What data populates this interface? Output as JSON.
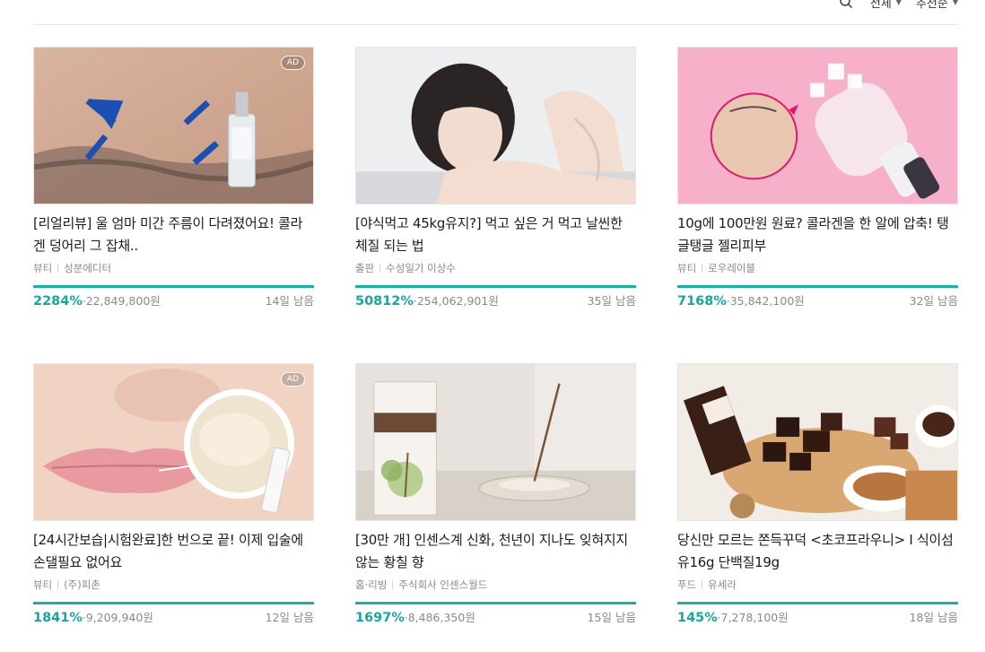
{
  "toolbar": {
    "search_icon": "search-icon",
    "filter_label": "전체",
    "sort_label": "추천순"
  },
  "cards": [
    {
      "ad": "AD",
      "title": "[리얼리뷰] 울 엄마 미간 주름이 다려졌어요! 콜라겐 덩어리 그 잡채..",
      "category": "뷰티",
      "maker": "성분에디터",
      "percent": "2284%",
      "amount": "22,849,800원",
      "days": "14일 남음",
      "progress": 1.0
    },
    {
      "ad": "",
      "title": "[야식먹고 45kg유지?] 먹고 싶은 거 먹고 날씬한 체질 되는 법",
      "category": "출판",
      "maker": "수성일기 이상수",
      "percent": "50812%",
      "amount": "254,062,901원",
      "days": "35일 남음",
      "progress": 1.0
    },
    {
      "ad": "",
      "title": "10g에 100만원 원료? 콜라겐을 한 알에 압축! 탱글탱글 젤리피부",
      "category": "뷰티",
      "maker": "로우레이블",
      "percent": "7168%",
      "amount": "35,842,100원",
      "days": "32일 남음",
      "progress": 1.0
    },
    {
      "ad": "AD",
      "title": "[24시간보습|시험완료]한 번으로 끝! 이제 입술에 손댈필요 없어요",
      "category": "뷰티",
      "maker": "(주)피촌",
      "percent": "1841%",
      "amount": "9,209,940원",
      "days": "12일 남음",
      "progress": 1.0
    },
    {
      "ad": "",
      "title": "[30만 개] 인센스계 신화, 천년이 지나도 잊혀지지 않는 황칠 향",
      "category": "홈·리빙",
      "maker": "주식회사 인센스월드",
      "percent": "1697%",
      "amount": "8,486,350원",
      "days": "15일 남음",
      "progress": 1.0
    },
    {
      "ad": "",
      "title": "당신만 모르는 쫀득꾸덕 <초코프라우니> I 식이섬유16g 단백질19g",
      "category": "푸드",
      "maker": "유세라",
      "percent": "145%",
      "amount": "7,278,100원",
      "days": "18일 남음",
      "progress": 1.0
    }
  ],
  "colors": {
    "accent": "#1aa59e",
    "progress_fill": "#1ab0a8",
    "progress_track": "#e8e8e8",
    "meta_text": "#8a8a8a"
  }
}
